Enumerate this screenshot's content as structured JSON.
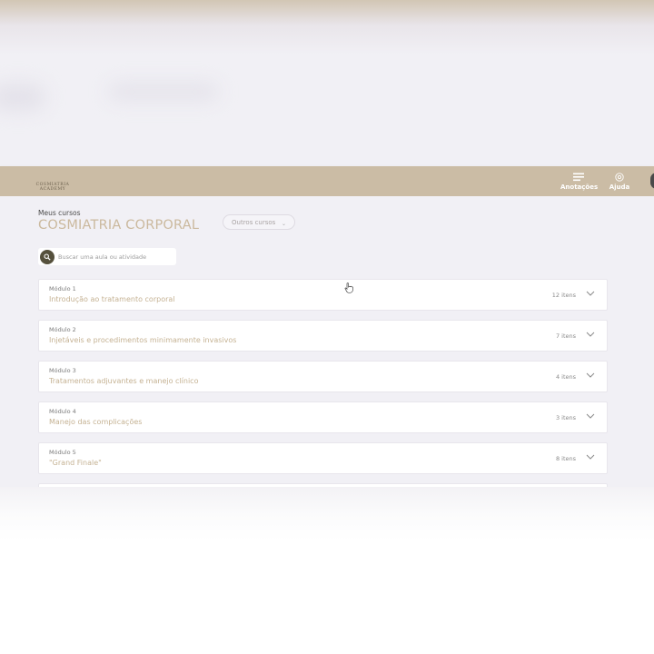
{
  "header": {
    "logo_line1": "COSMIATRIA",
    "logo_line2": "ACADEMY",
    "notes_label": "Anotações",
    "help_label": "Ajuda"
  },
  "page": {
    "breadcrumb": "Meus cursos",
    "course_title": "COSMIATRIA CORPORAL",
    "other_courses_label": "Outros cursos"
  },
  "search": {
    "placeholder": "Buscar uma aula ou atividade"
  },
  "modules": [
    {
      "number": "Módulo 1",
      "title": "Introdução ao tratamento corporal",
      "count": "12 itens"
    },
    {
      "number": "Módulo 2",
      "title": "Injetáveis e procedimentos minimamente invasivos",
      "count": "7 itens"
    },
    {
      "number": "Módulo 3",
      "title": "Tratamentos adjuvantes e manejo clínico",
      "count": "4 itens"
    },
    {
      "number": "Módulo 4",
      "title": "Manejo das complicações",
      "count": "3 itens"
    },
    {
      "number": "Módulo 5",
      "title": "\"Grand Finale\"",
      "count": "8 itens"
    }
  ],
  "colors": {
    "navbar": "#cbbca5",
    "accent_text": "#c5b293",
    "search_button": "#55503c"
  },
  "icons": {
    "notes": "notes-list-icon",
    "help": "help-circle-icon",
    "search": "search-icon",
    "expand": "chevron-down-icon",
    "cursor": "hand-cursor-icon"
  }
}
